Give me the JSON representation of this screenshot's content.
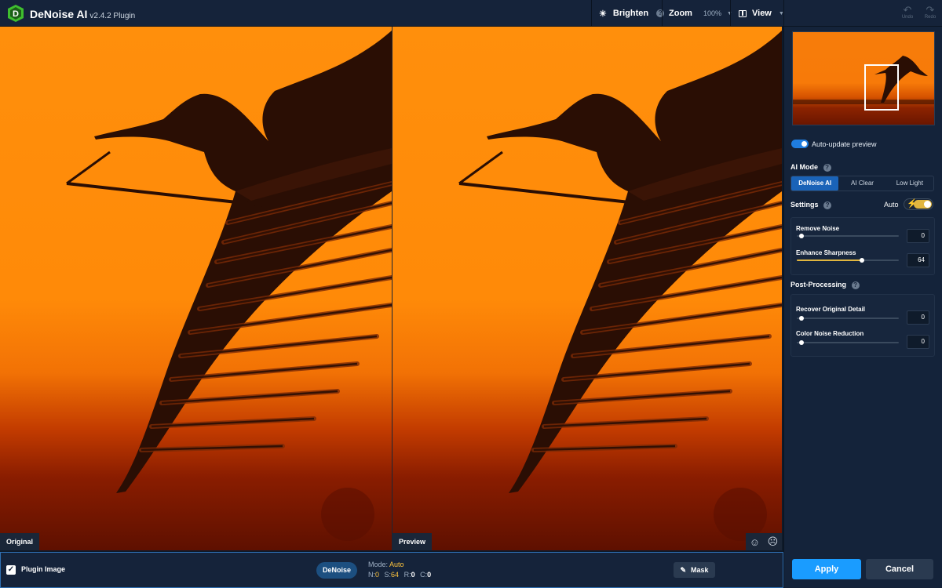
{
  "header": {
    "logo_letter": "D",
    "app_name": "DeNoise AI",
    "version": "v2.4.2 Plugin",
    "brighten_label": "Brighten",
    "zoom_label": "Zoom",
    "zoom_value": "100%",
    "view_label": "View",
    "undo_label": "Undo",
    "redo_label": "Redo"
  },
  "panes": {
    "left_label": "Original",
    "right_label": "Preview"
  },
  "bottom_bar": {
    "plugin_image_label": "Plugin Image",
    "plugin_image_checked": true,
    "denoise_button": "DeNoise",
    "mode_label": "Mode:",
    "mode_value": "Auto",
    "n_label": "N:",
    "n_value": "0",
    "s_label": "S:",
    "s_value": "64",
    "r_label": "R:",
    "r_value": "0",
    "c_label": "C:",
    "c_value": "0",
    "mask_button": "Mask"
  },
  "panel": {
    "auto_update_label": "Auto-update preview",
    "auto_update_on": true,
    "ai_mode_title": "AI Mode",
    "ai_modes": [
      "DeNoise AI",
      "AI Clear",
      "Low Light"
    ],
    "ai_mode_selected": "DeNoise AI",
    "settings_title": "Settings",
    "auto_label": "Auto",
    "auto_on": true,
    "remove_noise_label": "Remove Noise",
    "remove_noise_value": "0",
    "enhance_sharpness_label": "Enhance Sharpness",
    "enhance_sharpness_value": "64",
    "post_processing_title": "Post-Processing",
    "recover_detail_label": "Recover Original Detail",
    "recover_detail_value": "0",
    "color_noise_label": "Color Noise Reduction",
    "color_noise_value": "0",
    "apply_button": "Apply",
    "cancel_button": "Cancel"
  },
  "colors": {
    "accent_blue": "#1a9cff",
    "slider_gold": "#e1b63f",
    "sky_orange": "#ff8f0c",
    "panel_bg": "#14233a"
  }
}
